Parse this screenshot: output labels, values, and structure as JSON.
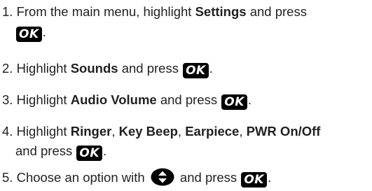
{
  "ok_key": {
    "label": "OK",
    "bg_color": "#000000",
    "text_color": "#ffffff"
  },
  "nav_key": {
    "icon": "up-down-navigation-key-icon",
    "color": "#000000"
  },
  "steps": [
    {
      "number": "1.",
      "line1_before": "From the main menu, highlight ",
      "line1_bold": "Settings",
      "line1_after": " and press",
      "line2_after": "."
    },
    {
      "number": "2.",
      "before": "Highlight ",
      "bold": "Sounds",
      "after": " and press ",
      "end": "."
    },
    {
      "number": "3.",
      "before": "Highlight ",
      "bold": "Audio Volume",
      "after": " and press ",
      "end": "."
    },
    {
      "number": "4.",
      "before": "Highlight ",
      "bold1": "Ringer",
      "sep1": ", ",
      "bold2": "Key Beep",
      "sep2": ", ",
      "bold3": "Earpiece",
      "sep3": ", ",
      "bold4": "PWR On/Off",
      "line2_before": "and press ",
      "line2_end": "."
    },
    {
      "number": "5.",
      "before": "Choose an option with ",
      "middle": " and press ",
      "end": "."
    }
  ]
}
